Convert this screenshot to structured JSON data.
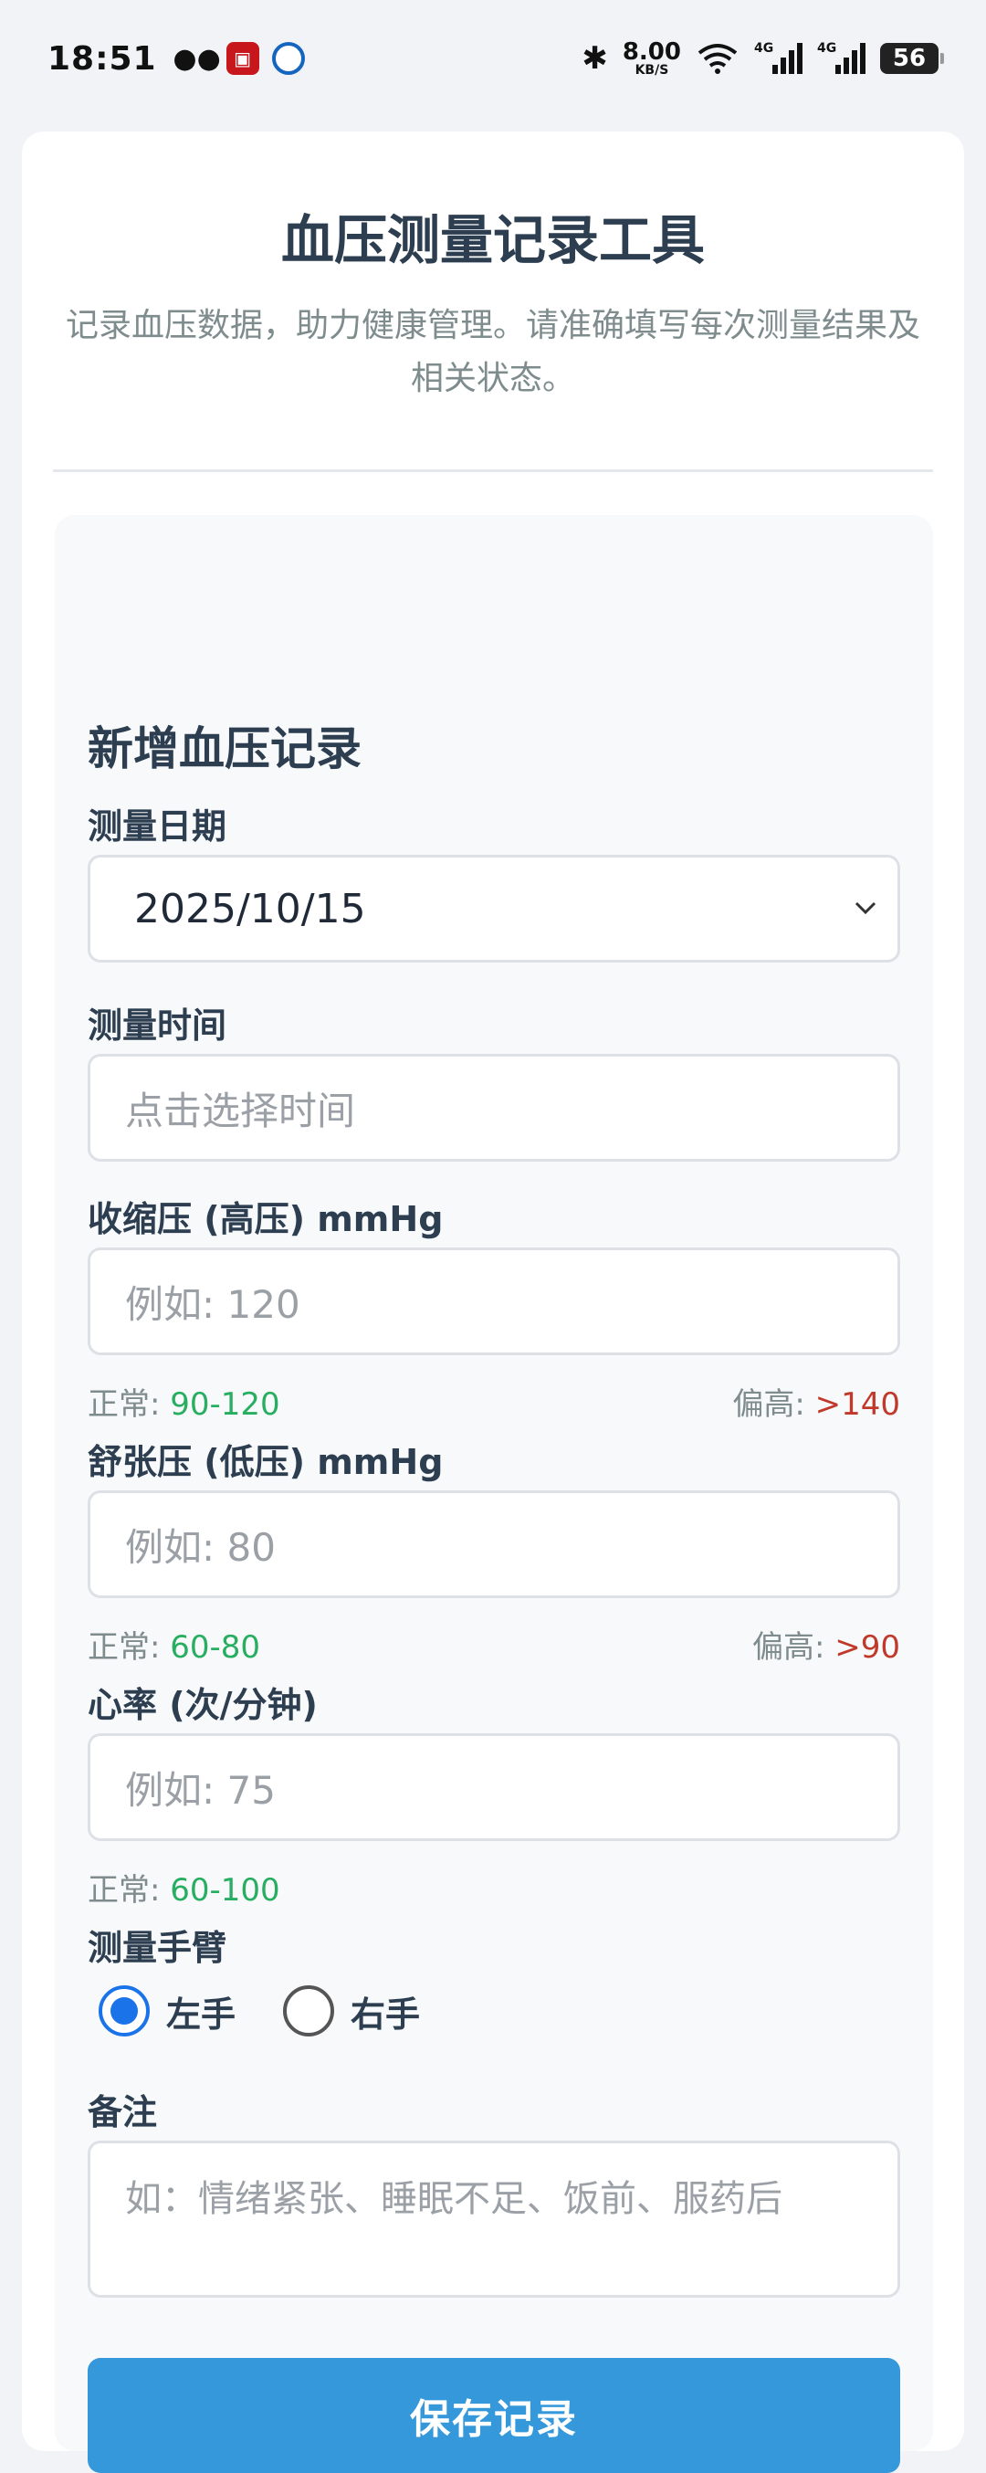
{
  "status_bar": {
    "time": "18:51",
    "speed_value": "8.00",
    "speed_unit": "KB/S",
    "net1": "4G",
    "net2": "4G",
    "battery": "56"
  },
  "header": {
    "title": "血压测量记录工具",
    "subtitle": "记录血压数据，助力健康管理。请准确填写每次测量结果及相关状态。"
  },
  "form": {
    "title": "新增血压记录",
    "date": {
      "label": "测量日期",
      "value": "2025/10/15"
    },
    "time": {
      "label": "测量时间",
      "placeholder": "点击选择时间"
    },
    "systolic": {
      "label": "收缩压 (高压) mmHg",
      "placeholder": "例如: 120",
      "normal_label": "正常: ",
      "normal_range": "90-120",
      "high_label": "偏高: ",
      "high_range": ">140"
    },
    "diastolic": {
      "label": "舒张压 (低压) mmHg",
      "placeholder": "例如: 80",
      "normal_label": "正常: ",
      "normal_range": "60-80",
      "high_label": "偏高: ",
      "high_range": ">90"
    },
    "heart_rate": {
      "label": "心率 (次/分钟)",
      "placeholder": "例如: 75",
      "normal_label": "正常: ",
      "normal_range": "60-100"
    },
    "arm": {
      "label": "测量手臂",
      "options": [
        "左手",
        "右手"
      ],
      "selected": "左手"
    },
    "notes": {
      "label": "备注",
      "placeholder": "如：情绪紧张、睡眠不足、饭前、服药后"
    },
    "save_label": "保存记录"
  },
  "colors": {
    "accent": "#3498db",
    "normal": "#27ae60",
    "high": "#c0392b",
    "radio": "#1a73e8"
  }
}
